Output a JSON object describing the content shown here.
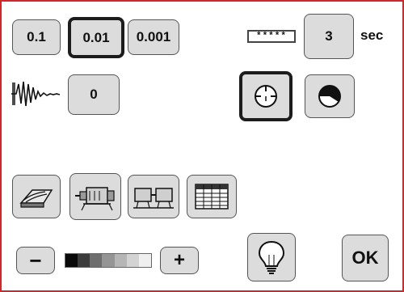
{
  "resolution_buttons": [
    {
      "label": "0.1",
      "selected": false
    },
    {
      "label": "0.01",
      "selected": true
    },
    {
      "label": "0.001",
      "selected": false
    }
  ],
  "password_field": {
    "value": "*****"
  },
  "time": {
    "value": "3",
    "unit": "sec"
  },
  "vibration": {
    "value": "0"
  },
  "mode_icons": [
    "timer-icon",
    "pie-chart-icon"
  ],
  "function_icons": [
    "cutting-tool-icon",
    "motor-icon",
    "dual-unit-icon",
    "spreadsheet-icon"
  ],
  "brightness": {
    "minus_label": "−",
    "plus_label": "+",
    "levels": [
      "#0a0a0a",
      "#3c3c3c",
      "#6e6e6e",
      "#959595",
      "#b6b6b6",
      "#d3d3d3",
      "#efefef"
    ]
  },
  "bulb_icon": "light-bulb-icon",
  "ok_button": {
    "label": "OK"
  },
  "colors": {
    "frame": "#cc2a2a",
    "button_face": "#dcdcdc"
  }
}
